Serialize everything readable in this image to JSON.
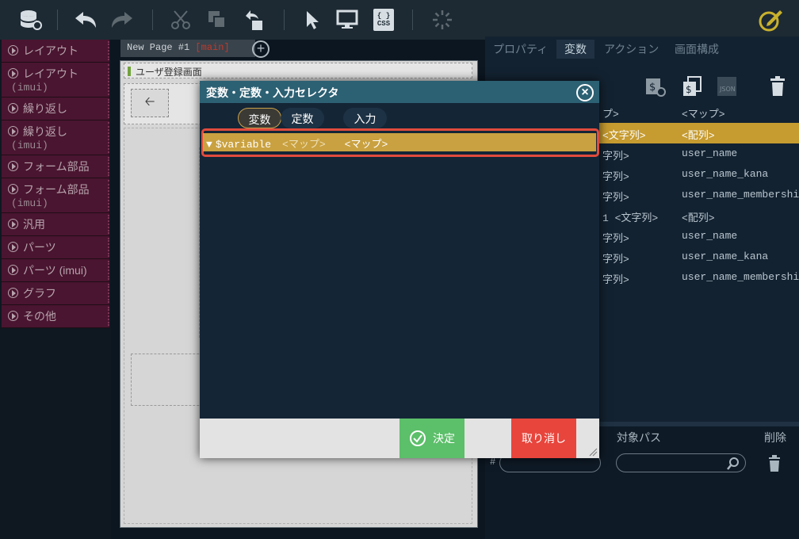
{
  "palette": {
    "items": [
      {
        "label": "レイアウト",
        "sub": ""
      },
      {
        "label": "レイアウト",
        "sub": "(imui)"
      },
      {
        "label": "繰り返し",
        "sub": ""
      },
      {
        "label": "繰り返し",
        "sub": "(imui)"
      },
      {
        "label": "フォーム部品",
        "sub": ""
      },
      {
        "label": "フォーム部品",
        "sub": "(imui)"
      },
      {
        "label": "汎用",
        "sub": ""
      },
      {
        "label": "パーツ",
        "sub": ""
      },
      {
        "label": "パーツ (imui)",
        "sub": ""
      },
      {
        "label": "グラフ",
        "sub": ""
      },
      {
        "label": "その他",
        "sub": ""
      }
    ]
  },
  "page_tab": {
    "name": "New Page #1",
    "branch": "[main]"
  },
  "canvas": {
    "heading": "ユーザ登録画面"
  },
  "right_panel": {
    "tabs": [
      "プロパティ",
      "変数",
      "アクション",
      "画面構成"
    ],
    "rows": [
      {
        "c1": "プ>",
        "c2": "<マップ>",
        "hl": false
      },
      {
        "c1": "<文字列>",
        "c2": "<配列>",
        "hl": true
      },
      {
        "c1": "字列>",
        "c2": "user_name",
        "hl": false
      },
      {
        "c1": "字列>",
        "c2": "user_name_kana",
        "hl": false
      },
      {
        "c1": "字列>",
        "c2": "user_name_membership",
        "hl": false
      },
      {
        "c1": "1  <文字列>",
        "c2": "<配列>",
        "hl": false
      },
      {
        "c1": "字列>",
        "c2": "user_name",
        "hl": false
      },
      {
        "c1": "字列>",
        "c2": "user_name_kana",
        "hl": false
      },
      {
        "c1": "字列>",
        "c2": "user_name_membership",
        "hl": false
      }
    ],
    "footer": {
      "hash": "#",
      "target_path": "対象パス",
      "delete": "削除"
    }
  },
  "modal": {
    "title": "変数・定数・入力セレクタ",
    "tabs": [
      "変数",
      "定数",
      "入力"
    ],
    "row": {
      "arrow": "▼",
      "name": "$variable",
      "type1": "<マップ>",
      "type2": "<マップ>"
    },
    "ok_label": "決定",
    "cancel_label": "取り消し"
  },
  "colors": {
    "accent_gold": "#c9a140",
    "highlight_red": "#e14b3d",
    "ok_green": "#5cbf6a",
    "cancel_red": "#e8453c",
    "modal_header": "#2c6073"
  }
}
